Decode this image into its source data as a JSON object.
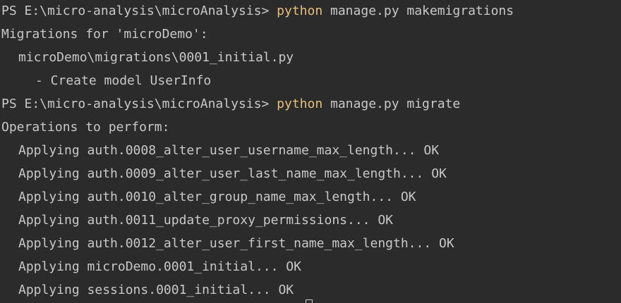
{
  "colors": {
    "background": "#2b2b2b",
    "text": "#c8c8c8",
    "command": "#e5c07b"
  },
  "lines": {
    "l1": {
      "prompt": "PS E:\\micro-analysis\\microAnalysis> ",
      "cmd": "python",
      "args": " manage.py makemigrations"
    },
    "l2": "Migrations for 'microDemo':",
    "l3": "microDemo\\migrations\\0001_initial.py",
    "l4": "- Create model UserInfo",
    "l5": {
      "prompt": "PS E:\\micro-analysis\\microAnalysis> ",
      "cmd": "python",
      "args": " manage.py migrate"
    },
    "l6": "Operations to perform:",
    "l7": "Applying auth.0008_alter_user_username_max_length... OK",
    "l8": "Applying auth.0009_alter_user_last_name_max_length... OK",
    "l9": "Applying auth.0010_alter_group_name_max_length... OK",
    "l10": "Applying auth.0011_update_proxy_permissions... OK",
    "l11": "Applying auth.0012_alter_user_first_name_max_length... OK",
    "l12": "Applying microDemo.0001_initial... OK",
    "l13": "Applying sessions.0001_initial... OK"
  }
}
